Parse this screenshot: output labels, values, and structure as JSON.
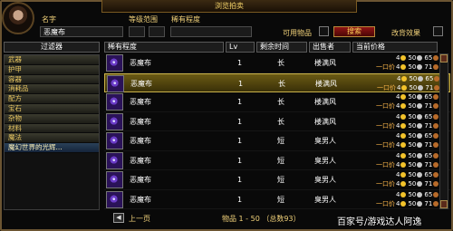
{
  "window": {
    "title": "浏览拍卖"
  },
  "filters": {
    "name_label": "名字",
    "name_value": "恶魔布",
    "level_range_label": "等级范围",
    "rarity_label": "稀有程度",
    "usable_label": "可用物品",
    "search_label": "搜索",
    "exact_match_label": "改背效果"
  },
  "left_panel": {
    "header": "过滤器",
    "items": [
      "武器",
      "护甲",
      "容器",
      "消耗品",
      "配方",
      "宝石",
      "杂物",
      "材料",
      "魔法",
      "魔幻世界的光辉..."
    ],
    "selected_index": 9
  },
  "columns": {
    "rarity": "稀有程度",
    "level": "Lv",
    "time_left": "剩余时间",
    "seller": "出售者",
    "price": "当前价格"
  },
  "rows": [
    {
      "name": "恶魔布",
      "level": "1",
      "time": "长",
      "seller": "楼满风",
      "bid_label": "一口价",
      "bid": {
        "g": "4",
        "s": "50",
        "c": "65"
      },
      "buyout": {
        "g": "4",
        "s": "50",
        "c": "71"
      }
    },
    {
      "name": "恶魔布",
      "level": "1",
      "time": "长",
      "seller": "楼满风",
      "bid_label": "一口价",
      "bid": {
        "g": "4",
        "s": "50",
        "c": "65"
      },
      "buyout": {
        "g": "4",
        "s": "50",
        "c": "71"
      }
    },
    {
      "name": "恶魔布",
      "level": "1",
      "time": "长",
      "seller": "楼满风",
      "bid_label": "一口价",
      "bid": {
        "g": "4",
        "s": "50",
        "c": "65"
      },
      "buyout": {
        "g": "4",
        "s": "50",
        "c": "71"
      }
    },
    {
      "name": "恶魔布",
      "level": "1",
      "time": "长",
      "seller": "楼满风",
      "bid_label": "一口价",
      "bid": {
        "g": "4",
        "s": "50",
        "c": "65"
      },
      "buyout": {
        "g": "4",
        "s": "50",
        "c": "71"
      }
    },
    {
      "name": "恶魔布",
      "level": "1",
      "time": "短",
      "seller": "臭男人",
      "bid_label": "一口价",
      "bid": {
        "g": "4",
        "s": "50",
        "c": "65"
      },
      "buyout": {
        "g": "4",
        "s": "50",
        "c": "71"
      }
    },
    {
      "name": "恶魔布",
      "level": "1",
      "time": "短",
      "seller": "臭男人",
      "bid_label": "一口价",
      "bid": {
        "g": "4",
        "s": "50",
        "c": "65"
      },
      "buyout": {
        "g": "4",
        "s": "50",
        "c": "71"
      }
    },
    {
      "name": "恶魔布",
      "level": "1",
      "time": "短",
      "seller": "臭男人",
      "bid_label": "一口价",
      "bid": {
        "g": "4",
        "s": "50",
        "c": "65"
      },
      "buyout": {
        "g": "4",
        "s": "50",
        "c": "71"
      }
    },
    {
      "name": "恶魔布",
      "level": "1",
      "time": "短",
      "seller": "臭男人",
      "bid_label": "一口价",
      "bid": {
        "g": "4",
        "s": "50",
        "c": "65"
      },
      "buyout": {
        "g": "4",
        "s": "50",
        "c": "71"
      }
    }
  ],
  "selected_row_index": 1,
  "footer": {
    "prev_label": "上一页",
    "range_text": "物品 1 - 50 （总数93）",
    "watermark": "百家号/游戏达人阿逸"
  }
}
